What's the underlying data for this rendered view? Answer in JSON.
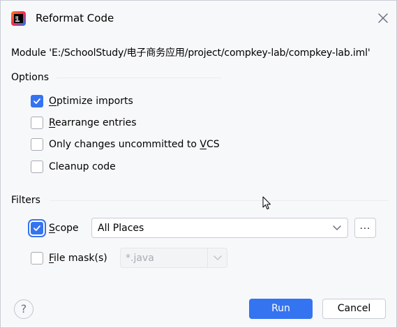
{
  "window": {
    "title": "Reformat Code",
    "app_icon": "intellij-idea-icon",
    "close_icon": "close-icon"
  },
  "module_line": "Module 'E:/SchoolStudy/电子商务应用/project/compkey-lab/compkey-lab.iml'",
  "options": {
    "heading": "Options",
    "items": [
      {
        "mnemonic": "O",
        "rest": "ptimize imports",
        "checked": true
      },
      {
        "mnemonic": "R",
        "rest": "earrange entries",
        "checked": false
      },
      {
        "prefix": "Only changes uncommitted to ",
        "mnemonic": "V",
        "rest": "CS",
        "checked": false
      },
      {
        "label": "Cleanup code",
        "checked": false
      }
    ]
  },
  "filters": {
    "heading": "Filters",
    "scope": {
      "mnemonic": "S",
      "rest": "cope",
      "checked": true,
      "selected_value": "All Places",
      "browse_label": "..."
    },
    "file_mask": {
      "mnemonic": "F",
      "rest": "ile mask(s)",
      "checked": false,
      "value": "*.java"
    }
  },
  "footer": {
    "help_label": "?",
    "run_label": "Run",
    "cancel_label": "Cancel"
  },
  "colors": {
    "accent": "#3574f0",
    "background": "#f7f8fa",
    "border": "#c9ccd6",
    "disabled_text": "#a8abb2"
  }
}
